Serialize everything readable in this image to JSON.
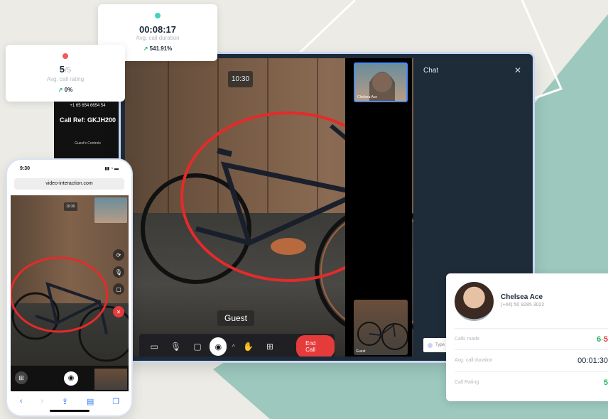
{
  "colors": {
    "accent": "#e63b3b",
    "green": "#23b35d",
    "teal_dot": "#3fd3c0",
    "red_dot": "#f05a5a",
    "focus": "#4e8cf5"
  },
  "stat_cards": {
    "duration": {
      "value": "00:08:17",
      "label": "Avg. call duration",
      "trend": "541.91%"
    },
    "rating": {
      "value": "5",
      "suffix": "/5",
      "label": "Avg. call rating",
      "trend": "0%"
    }
  },
  "desktop": {
    "time": "10:30",
    "guest_label": "Guest",
    "end_call": "End Call",
    "chat_title": "Chat",
    "chat_placeholder": "Type",
    "thumb_top_label": "Chelsea Ace",
    "thumb_bottom_label": "Guest",
    "controls": [
      "screen-icon",
      "microphone-icon",
      "camera-icon",
      "record-icon",
      "hand-icon",
      "grid-icon"
    ]
  },
  "phone_back": {
    "number": "+1 65 654 6654 54",
    "ref": "Call Ref: GKJH200",
    "guest_controls": "Guest's Controls"
  },
  "phone": {
    "time": "9:30",
    "url": "video-interaction.com",
    "video_time": "10:30"
  },
  "contact": {
    "name": "Chelsea Ace",
    "phone": "(+44) 50 9285 3022",
    "rows": [
      {
        "label": "Calls made",
        "value_a": "6",
        "value_b": "5"
      },
      {
        "label": "Avg. call duration",
        "value": "00:01:30"
      },
      {
        "label": "Call Rating",
        "value": "5"
      }
    ]
  }
}
